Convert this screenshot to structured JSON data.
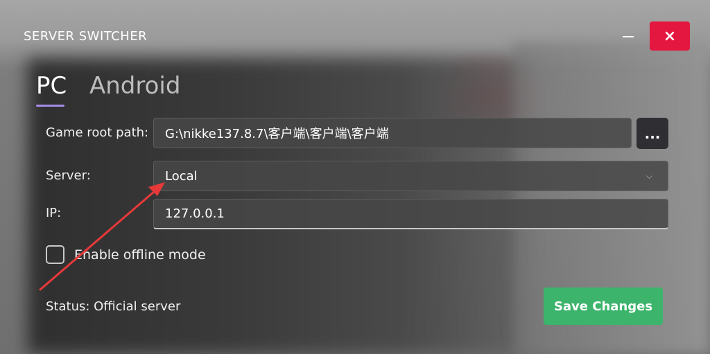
{
  "window": {
    "title": "SERVER SWITCHER",
    "minimize_icon": "minimize-icon",
    "close_icon": "close-icon",
    "close_glyph": "×"
  },
  "tabs": [
    {
      "label": "PC",
      "selected": true
    },
    {
      "label": "Android",
      "selected": false
    }
  ],
  "form": {
    "game_root_path_label": "Game root path:",
    "game_root_path_value": "G:\\nikke137.8.7\\客户端\\客户端\\客户端",
    "browse_label": "...",
    "server_label": "Server:",
    "server_value": "Local",
    "server_dropdown_icon": "chevron-down-icon",
    "chevron_glyph": "⌵",
    "ip_label": "IP:",
    "ip_value": "127.0.0.1",
    "offline_mode_label": "Enable offline mode",
    "offline_mode_checked": false
  },
  "status": {
    "text": "Status: Official server"
  },
  "actions": {
    "save_label": "Save Changes"
  },
  "colors": {
    "close_button": "#e3173f",
    "save_button": "#3cb46c",
    "tab_indicator": "#a58de6",
    "annotation_arrow": "#e8393a"
  }
}
